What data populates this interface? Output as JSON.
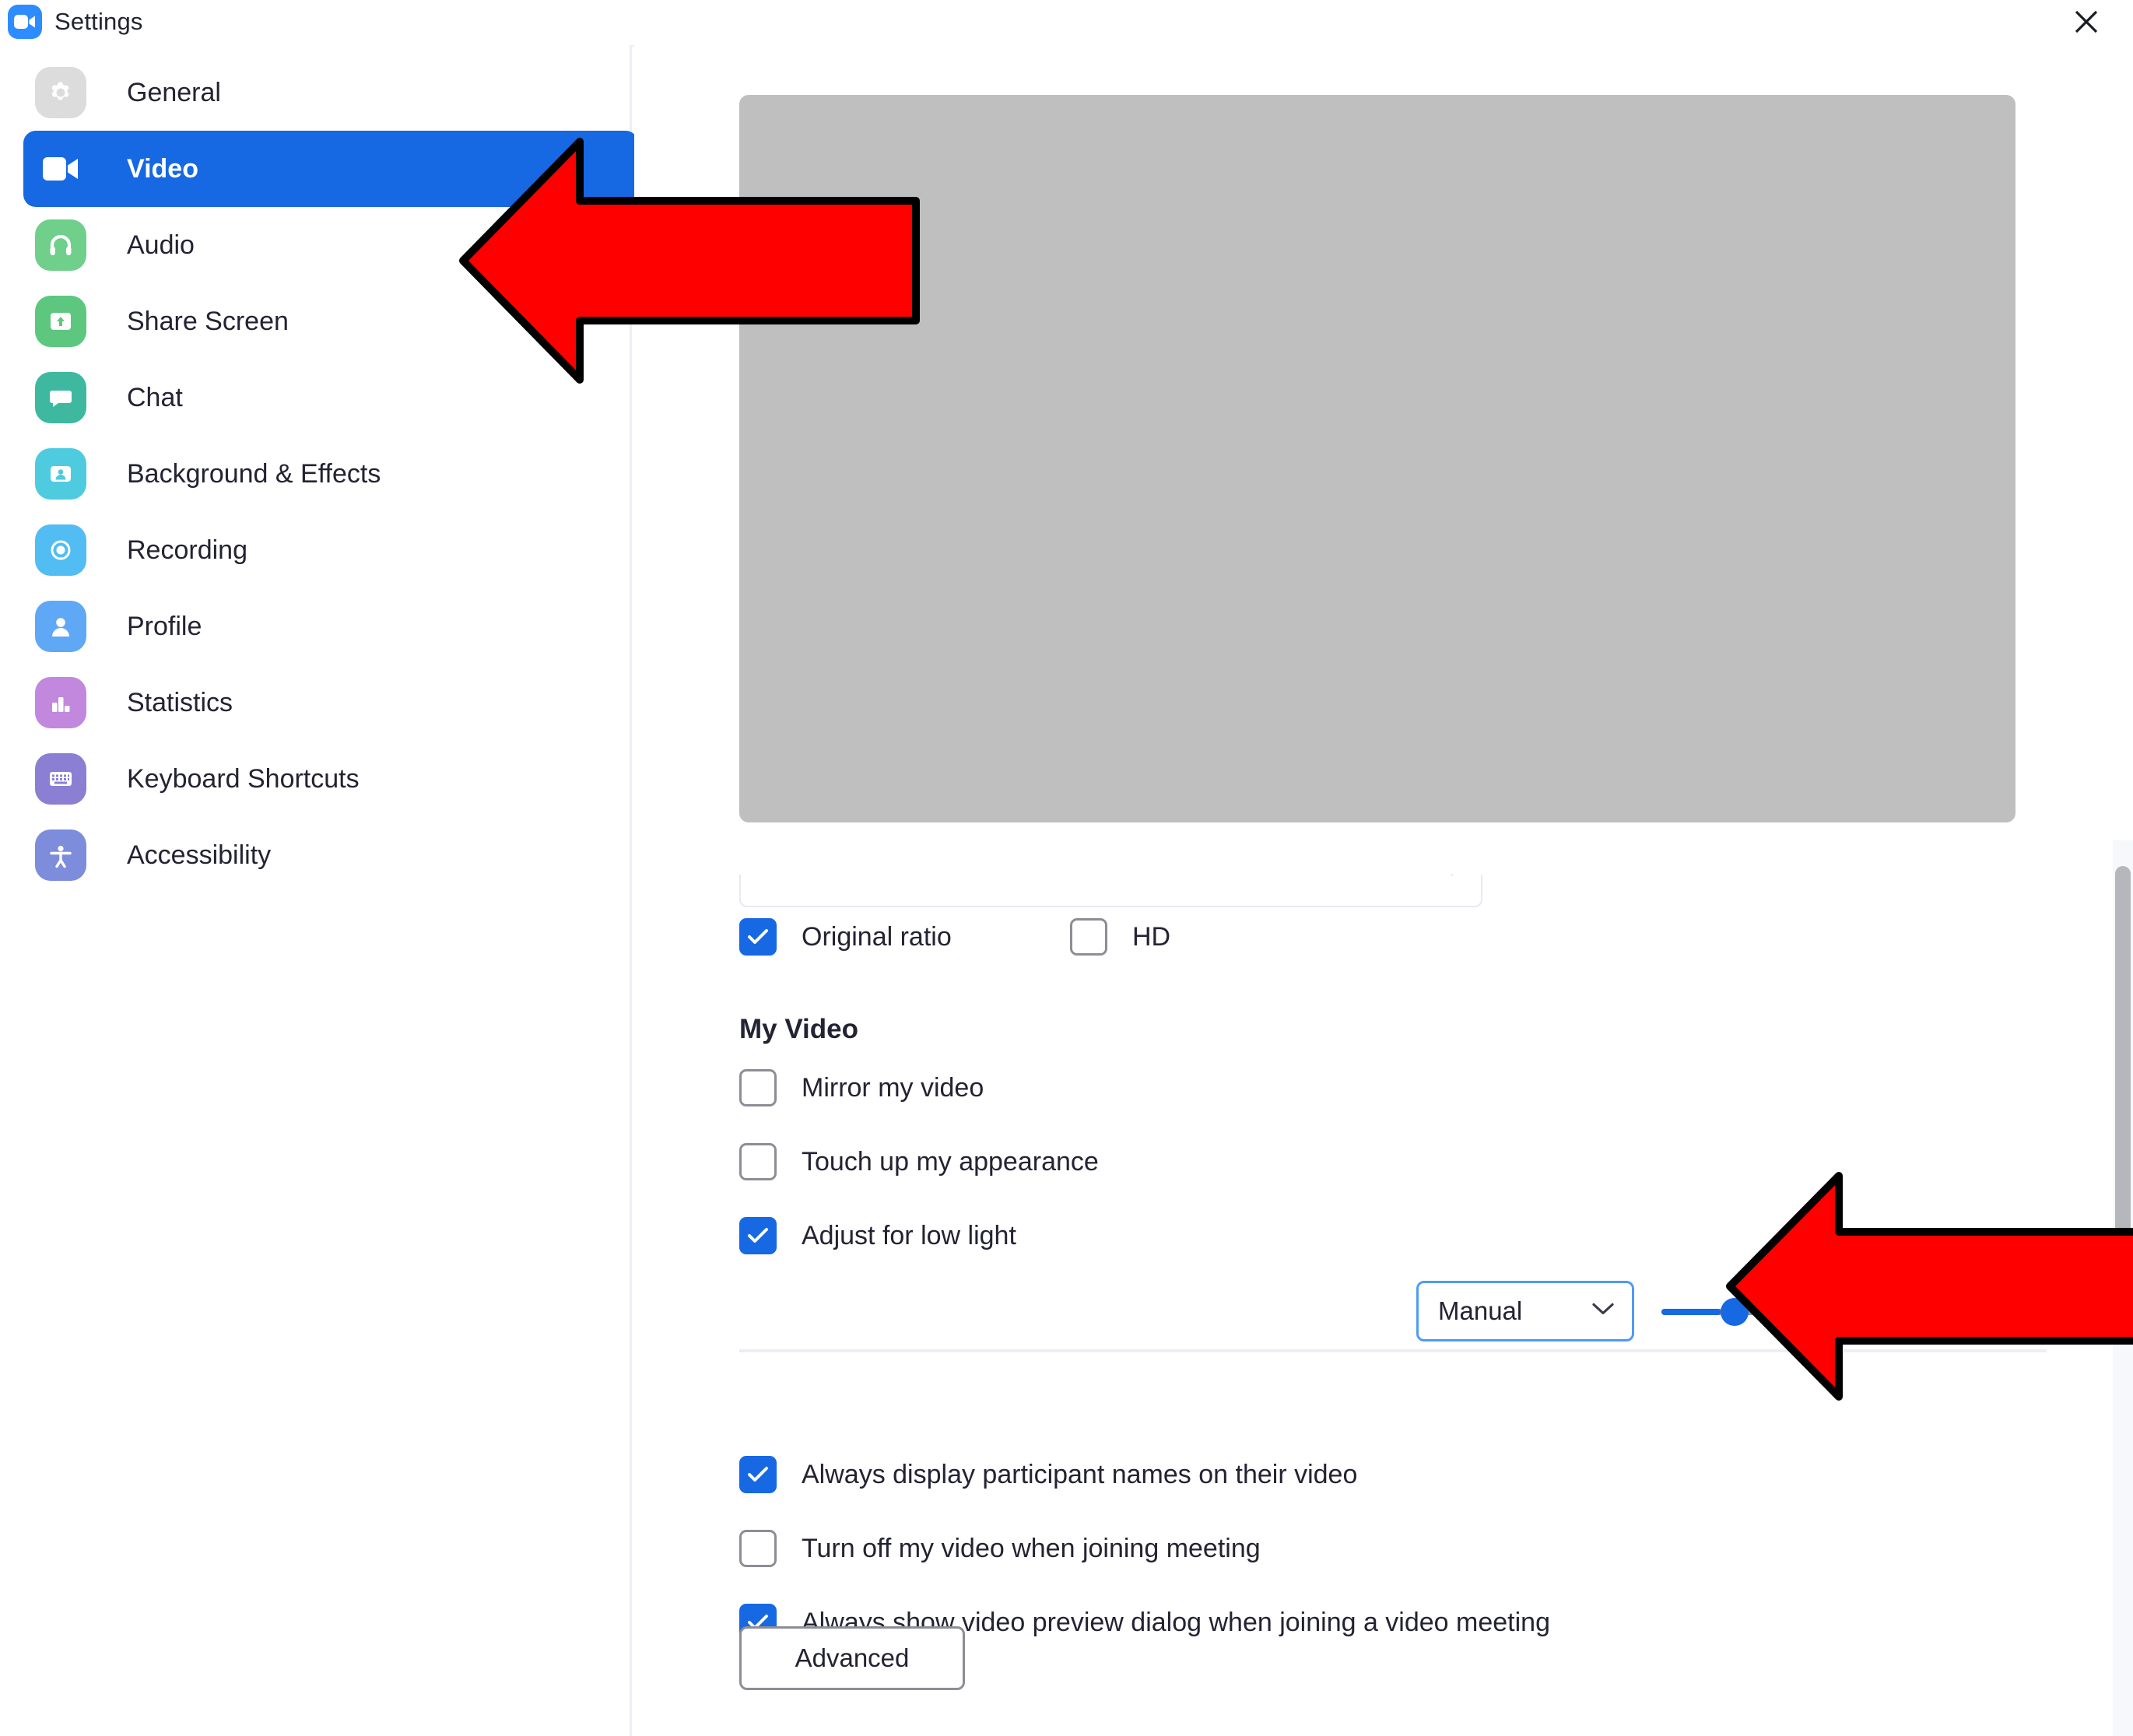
{
  "window": {
    "title": "Settings",
    "app_icon": "zoom-video-icon",
    "close_icon": "close-icon"
  },
  "sidebar": {
    "items": [
      {
        "label": "General",
        "icon": "gear-icon",
        "color": "#dcdcdc",
        "active": false
      },
      {
        "label": "Video",
        "icon": "video-camera-icon",
        "color": "#1668e3",
        "active": true
      },
      {
        "label": "Audio",
        "icon": "headset-icon",
        "color": "#6fcf8b",
        "active": false
      },
      {
        "label": "Share Screen",
        "icon": "share-screen-icon",
        "color": "#5ec77f",
        "active": false
      },
      {
        "label": "Chat",
        "icon": "chat-bubble-icon",
        "color": "#3fb8a0",
        "active": false
      },
      {
        "label": "Background & Effects",
        "icon": "background-person-icon",
        "color": "#4fcbe0",
        "active": false
      },
      {
        "label": "Recording",
        "icon": "record-circle-icon",
        "color": "#52bdf2",
        "active": false
      },
      {
        "label": "Profile",
        "icon": "person-icon",
        "color": "#5fa8f5",
        "active": false
      },
      {
        "label": "Statistics",
        "icon": "bar-chart-icon",
        "color": "#c288dd",
        "active": false
      },
      {
        "label": "Keyboard Shortcuts",
        "icon": "keyboard-icon",
        "color": "#8b7fd4",
        "active": false
      },
      {
        "label": "Accessibility",
        "icon": "accessibility-icon",
        "color": "#7d8ddb",
        "active": false
      }
    ]
  },
  "content": {
    "camera_select": {
      "value": "",
      "chevron_icon": "chevron-down-icon"
    },
    "ratio_row": [
      {
        "label": "Original ratio",
        "checked": true
      },
      {
        "label": "HD",
        "checked": false
      }
    ],
    "my_video": {
      "heading": "My Video",
      "options": [
        {
          "label": "Mirror my video",
          "checked": false
        },
        {
          "label": "Touch up my appearance",
          "checked": false
        },
        {
          "label": "Adjust for low light",
          "checked": true
        }
      ],
      "low_light_mode": {
        "value": "Manual",
        "chevron_icon": "chevron-down-icon",
        "slider_percent": 17
      }
    },
    "meeting_options": [
      {
        "label": "Always display participant names on their video",
        "checked": true
      },
      {
        "label": "Turn off my video when joining meeting",
        "checked": false
      },
      {
        "label": "Always show video preview dialog when joining a video meeting",
        "checked": true
      }
    ],
    "advanced_button": "Advanced"
  },
  "annotations": {
    "arrows": [
      {
        "name": "arrow-pointing-to-video-tab",
        "color": "#ff0000"
      },
      {
        "name": "arrow-pointing-to-low-light-slider",
        "color": "#ff0000"
      }
    ]
  },
  "colors": {
    "accent": "#1668e3",
    "annotation_red": "#ff0000",
    "preview_placeholder": "#bfbfbf"
  }
}
